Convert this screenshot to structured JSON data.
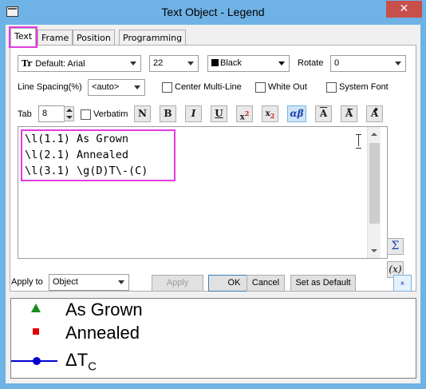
{
  "window": {
    "title": "Text Object - Legend",
    "close_glyph": "✕"
  },
  "tabs": [
    {
      "label": "Text"
    },
    {
      "label": "Frame"
    },
    {
      "label": "Position"
    },
    {
      "label": "Programming"
    }
  ],
  "font": {
    "value": "Default: Arial",
    "icon": "font-tt-icon"
  },
  "size": {
    "value": "22"
  },
  "color": {
    "value": "Black",
    "swatch": "#000000"
  },
  "rotate": {
    "label": "Rotate",
    "value": "0"
  },
  "line_spacing": {
    "label": "Line Spacing(%)",
    "value": "<auto>"
  },
  "checks": {
    "center_multiline": "Center Multi-Line",
    "white_out": "White Out",
    "system_font": "System Font",
    "verbatim": "Verbatim"
  },
  "tab": {
    "label": "Tab",
    "value": "8"
  },
  "format_buttons": {
    "normal": "N",
    "bold": "B",
    "italic": "I",
    "underline": "U",
    "superscript_base": "x",
    "superscript_mark": "2",
    "subscript_base": "x",
    "subscript_mark": "2",
    "greek": "αβ",
    "overbar": "A",
    "tilde": "A",
    "dot": "A"
  },
  "editor": {
    "lines": [
      "\\l(1.1) As Grown",
      "\\l(2.1) Annealed",
      "\\l(3.1) \\g(D)T\\-(C)"
    ]
  },
  "side_buttons": {
    "sigma": "Σ",
    "function": "(x)"
  },
  "apply_to": {
    "label": "Apply to",
    "value": "Object"
  },
  "buttons": {
    "apply": "Apply",
    "ok": "OK",
    "cancel": "Cancel",
    "set_default": "Set as Default",
    "collapse": "«"
  },
  "preview": {
    "items": [
      {
        "text": "As Grown",
        "symbol": "triangle",
        "color": "#1a8c1a"
      },
      {
        "text": "Annealed",
        "symbol": "square",
        "color": "#e00000"
      },
      {
        "text": "ΔT",
        "subscript": "C",
        "symbol": "line-circle",
        "color": "#0000d0"
      }
    ]
  },
  "colors": {
    "highlight": "#e23be2",
    "title_bar": "#6fb2e6",
    "close": "#c7504a"
  }
}
